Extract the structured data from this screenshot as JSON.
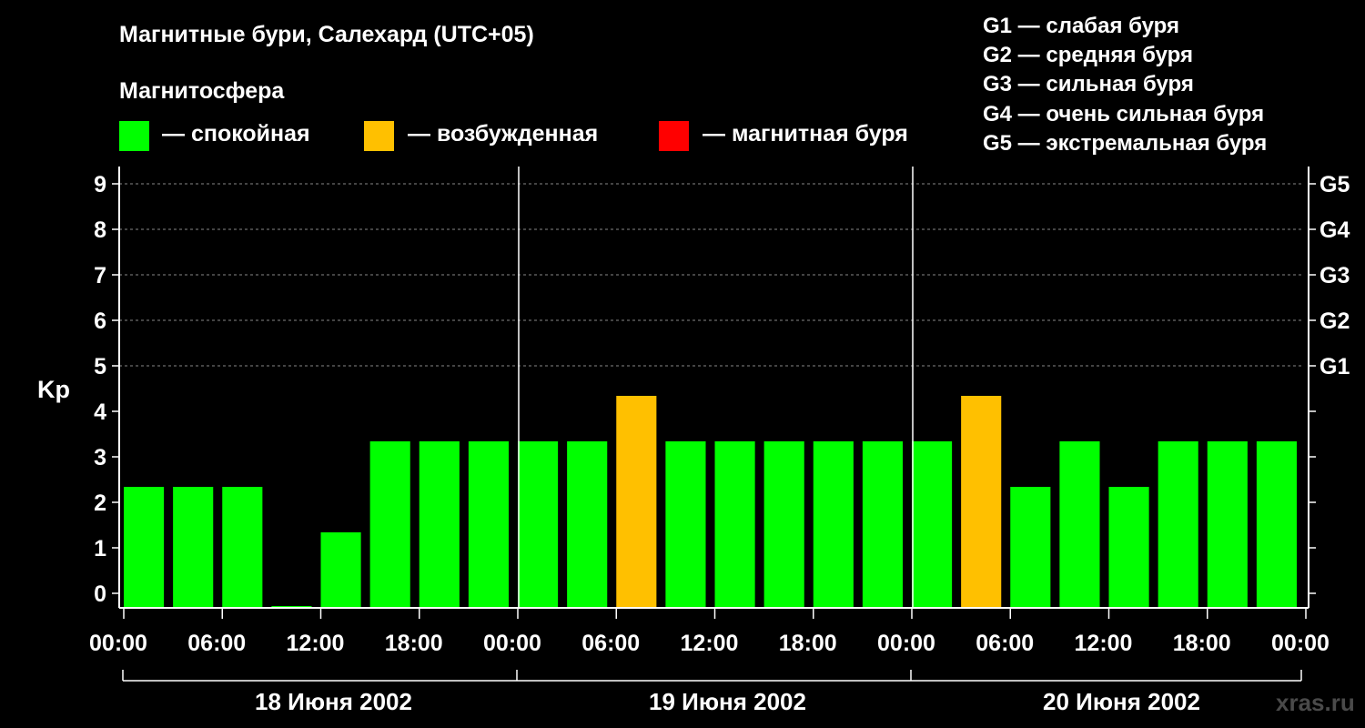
{
  "title": "Магнитные бури, Салехард (UTC+05)",
  "legend": {
    "heading": "Магнитосфера",
    "items": [
      {
        "color": "#00ff00",
        "label": "— спокойная"
      },
      {
        "color": "#ffc000",
        "label": "— возбужденная"
      },
      {
        "color": "#ff0000",
        "label": "— магнитная буря"
      }
    ]
  },
  "g_legend": [
    "G1 — слабая буря",
    "G2 — средняя буря",
    "G3 — сильная буря",
    "G4 — очень сильная буря",
    "G5 — экстремальная буря"
  ],
  "watermark": "xras.ru",
  "chart_data": {
    "type": "bar",
    "ylabel": "Kp",
    "ylim": [
      0,
      9
    ],
    "yticks": [
      0,
      1,
      2,
      3,
      4,
      5,
      6,
      7,
      8,
      9
    ],
    "right_labels": [
      {
        "y": 5,
        "label": "G1"
      },
      {
        "y": 6,
        "label": "G2"
      },
      {
        "y": 7,
        "label": "G3"
      },
      {
        "y": 8,
        "label": "G4"
      },
      {
        "y": 9,
        "label": "G5"
      }
    ],
    "grid": true,
    "xlim": [
      "18.06.2002 00:00",
      "21.06.2002 00:00"
    ],
    "xticks": [
      "00:00",
      "06:00",
      "12:00",
      "18:00",
      "00:00",
      "06:00",
      "12:00",
      "18:00",
      "00:00",
      "06:00",
      "12:00",
      "18:00",
      "00:00"
    ],
    "days": [
      "18 Июня 2002",
      "19 Июня 2002",
      "20 Июня 2002"
    ],
    "categories": [
      "18.06 00:00",
      "18.06 03:00",
      "18.06 06:00",
      "18.06 09:00",
      "18.06 12:00",
      "18.06 15:00",
      "18.06 18:00",
      "18.06 21:00",
      "19.06 00:00",
      "19.06 03:00",
      "19.06 06:00",
      "19.06 09:00",
      "19.06 12:00",
      "19.06 15:00",
      "19.06 18:00",
      "19.06 21:00",
      "20.06 00:00",
      "20.06 03:00",
      "20.06 06:00",
      "20.06 09:00",
      "20.06 12:00",
      "20.06 15:00",
      "20.06 18:00",
      "20.06 21:00"
    ],
    "values": [
      2,
      2,
      2,
      0,
      1,
      3,
      3,
      3,
      3,
      3,
      4,
      3,
      3,
      3,
      3,
      3,
      3,
      4,
      2,
      3,
      2,
      3,
      3,
      3
    ],
    "status": [
      "quiet",
      "quiet",
      "quiet",
      "quiet",
      "quiet",
      "quiet",
      "quiet",
      "quiet",
      "quiet",
      "quiet",
      "excited",
      "quiet",
      "quiet",
      "quiet",
      "quiet",
      "quiet",
      "quiet",
      "excited",
      "quiet",
      "quiet",
      "quiet",
      "quiet",
      "quiet",
      "quiet"
    ],
    "colors": {
      "quiet": "#00ff00",
      "excited": "#ffc000",
      "storm": "#ff0000"
    }
  }
}
